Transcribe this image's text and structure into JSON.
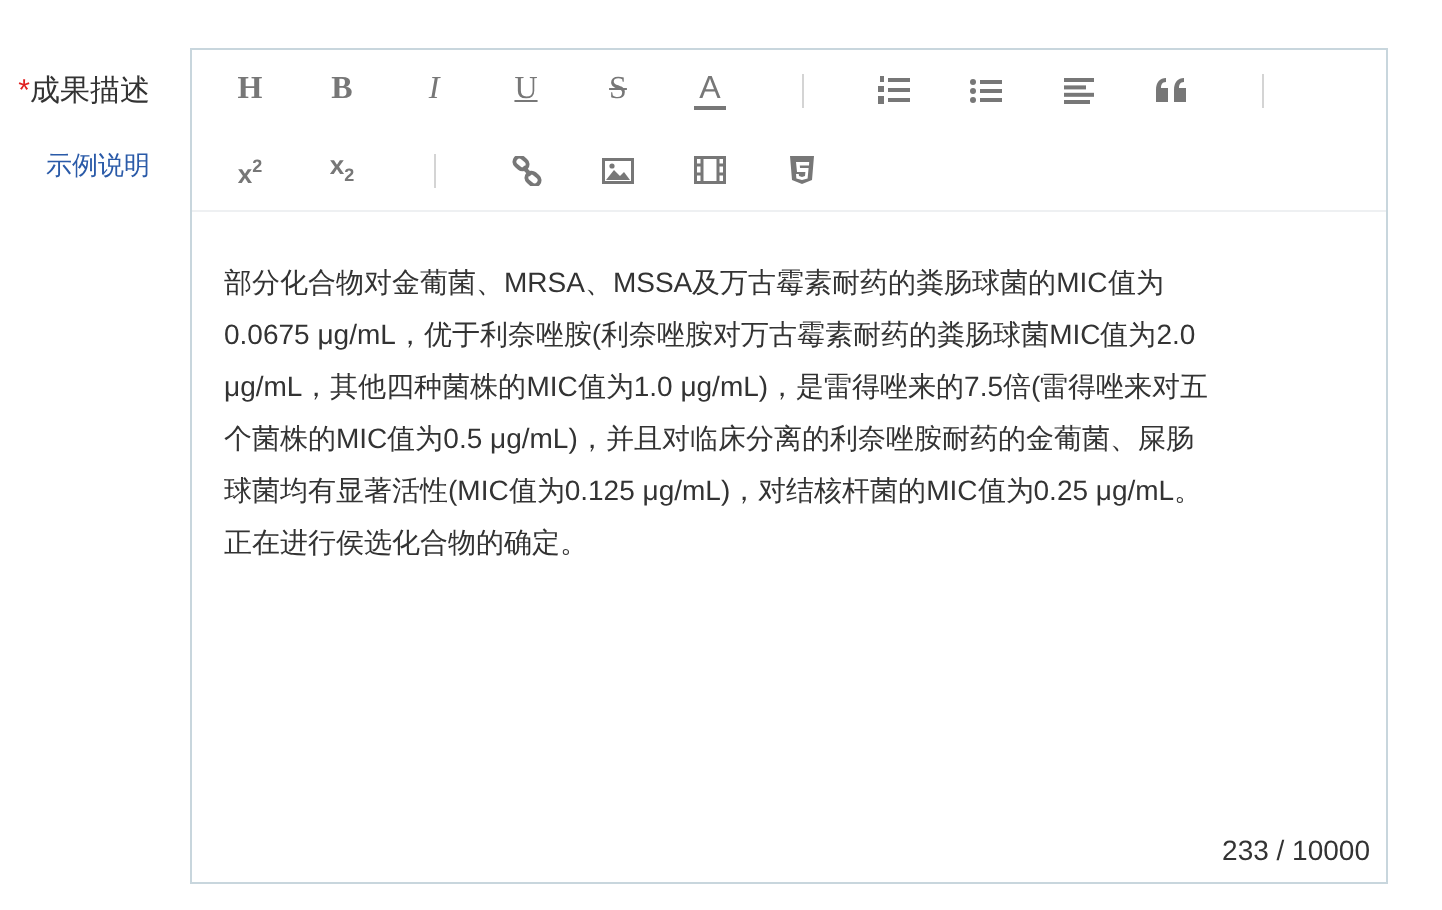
{
  "field": {
    "label": "成果描述",
    "required_mark": "*",
    "help_link": "示例说明"
  },
  "toolbar": [
    {
      "kind": "heading",
      "label": "H"
    },
    {
      "kind": "bold",
      "label": "B"
    },
    {
      "kind": "italic",
      "label": "I"
    },
    {
      "kind": "underline",
      "label": "U"
    },
    {
      "kind": "strike",
      "label": "S"
    },
    {
      "kind": "color",
      "label": "A"
    },
    {
      "kind": "separator"
    },
    {
      "kind": "ordered-list"
    },
    {
      "kind": "bullet-list"
    },
    {
      "kind": "align"
    },
    {
      "kind": "quote"
    },
    {
      "kind": "separator"
    },
    {
      "kind": "superscript",
      "label": "x$^{2}$"
    },
    {
      "kind": "subscript",
      "label": "x$_{2}$"
    },
    {
      "kind": "separator"
    },
    {
      "kind": "link"
    },
    {
      "kind": "image"
    },
    {
      "kind": "video"
    },
    {
      "kind": "html5"
    }
  ],
  "content_lines": [
    "部分化合物对金葡菌、MRSA、MSSA及万古霉素耐药的粪肠球菌的MIC值为",
    "0.0675 μg/mL，优于利奈唑胺(利奈唑胺对万古霉素耐药的粪肠球菌MIC值为2.0",
    "μg/mL，其他四种菌株的MIC值为1.0 μg/mL)，是雷得唑来的7.5倍(雷得唑来对五",
    "个菌株的MIC值为0.5 μg/mL)，并且对临床分离的利奈唑胺耐药的金葡菌、屎肠",
    "球菌均有显著活性(MIC值为0.125 μg/mL)，对结核杆菌的MIC值为0.25 μg/mL。",
    "正在进行侯选化合物的确定。"
  ],
  "counter": "233 / 10000"
}
